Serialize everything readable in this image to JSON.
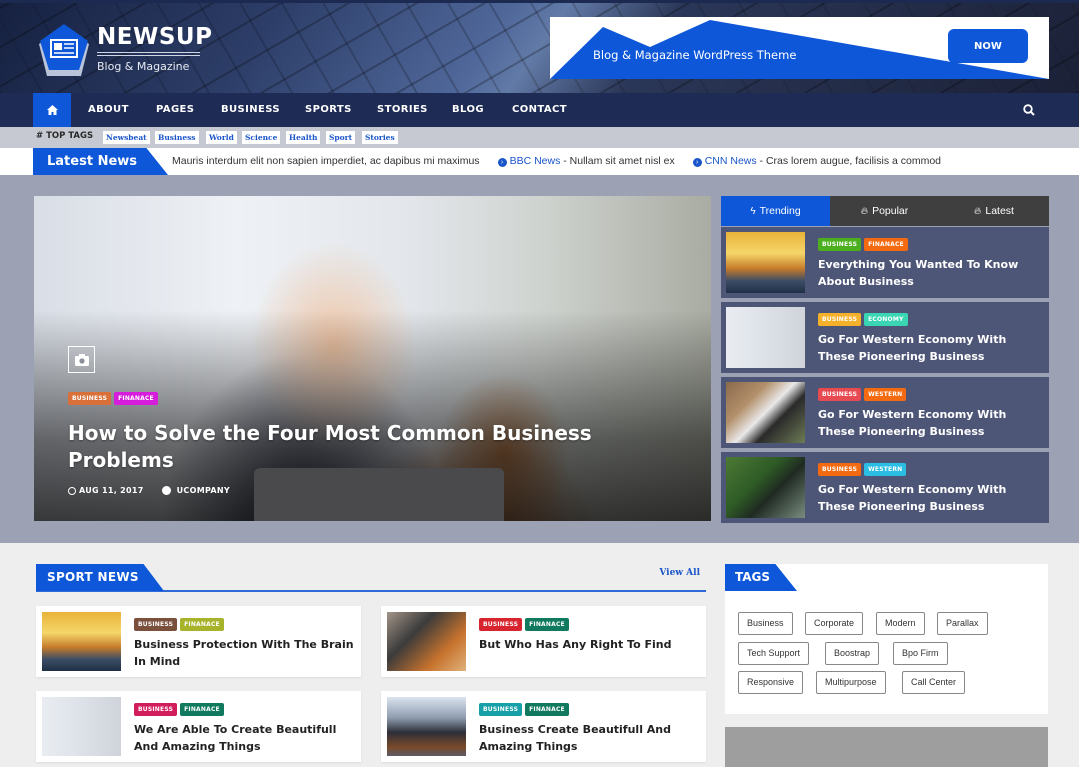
{
  "header": {
    "logo_title": "NEWSUP",
    "logo_subtitle": "Blog & Magazine",
    "ad_text": "Blog & Magazine WordPress Theme",
    "ad_button": "NOW"
  },
  "nav": {
    "home_icon": "home-icon",
    "items": [
      "ABOUT",
      "PAGES",
      "BUSINESS",
      "SPORTS",
      "STORIES",
      "BLOG",
      "CONTACT"
    ],
    "search_icon": "search-icon"
  },
  "top_tags": {
    "label": "# TOP TAGS",
    "tags": [
      "Newsbeat",
      "Business",
      "World",
      "Science",
      "Health",
      "Sport",
      "Stories"
    ]
  },
  "ticker": {
    "label": "Latest News",
    "items": [
      {
        "source": "",
        "text": "Mauris interdum elit non sapien imperdiet, ac dapibus mi maximus"
      },
      {
        "source": "BBC News",
        "text": " - Nullam sit amet nisl ex"
      },
      {
        "source": "CNN News",
        "text": " - Cras lorem augue, facilisis a commod"
      }
    ]
  },
  "hero": {
    "badges": [
      {
        "label": "BUSINESS",
        "color": "#d9703a"
      },
      {
        "label": "FINANACE",
        "color": "#d61ddb"
      }
    ],
    "title": "How to Solve the Four Most Common Business Problems",
    "date": "AUG 11, 2017",
    "author": "UCOMPANY"
  },
  "tabs": {
    "items": [
      {
        "label": "Trending",
        "icon": "bolt-icon",
        "active": true
      },
      {
        "label": "Popular",
        "icon": "fire-icon",
        "active": false
      },
      {
        "label": "Latest",
        "icon": "fire-icon",
        "active": false
      }
    ]
  },
  "trending": [
    {
      "title": "Everything You Wanted To Know About Business",
      "badges": [
        {
          "label": "BUSINESS",
          "color": "#4caf1d"
        },
        {
          "label": "FINANACE",
          "color": "#f36a10"
        }
      ]
    },
    {
      "title": "Go For Western Economy With These Pioneering Business",
      "badges": [
        {
          "label": "BUSINESS",
          "color": "#f6b12a"
        },
        {
          "label": "ECONOMY",
          "color": "#3ad6b3"
        }
      ]
    },
    {
      "title": "Go For Western Economy With These Pioneering Business",
      "badges": [
        {
          "label": "BUSINESS",
          "color": "#e84a52"
        },
        {
          "label": "WESTERN",
          "color": "#f36a10"
        }
      ]
    },
    {
      "title": "Go For Western Economy With These Pioneering Business",
      "badges": [
        {
          "label": "BUSINESS",
          "color": "#f36a10"
        },
        {
          "label": "WESTERN",
          "color": "#2cbde4"
        }
      ]
    }
  ],
  "sport_news": {
    "title": "SPORT NEWS",
    "view_all": "View All",
    "cards": [
      {
        "title": "Business Protection With The Brain In Mind",
        "badges": [
          {
            "label": "BUSINESS",
            "color": "#7a4f3c"
          },
          {
            "label": "FINANACE",
            "color": "#a6b32b"
          }
        ]
      },
      {
        "title": "But Who Has Any Right To Find",
        "badges": [
          {
            "label": "BUSINESS",
            "color": "#d8242f"
          },
          {
            "label": "FINANACE",
            "color": "#117a5e"
          }
        ]
      },
      {
        "title": "We Are Able To Create Beautifull And Amazing Things",
        "badges": [
          {
            "label": "BUSINESS",
            "color": "#d21d5c"
          },
          {
            "label": "FINANACE",
            "color": "#117a5e"
          }
        ]
      },
      {
        "title": "Business Create Beautifull And Amazing Things",
        "badges": [
          {
            "label": "BUSINESS",
            "color": "#17a0a8"
          },
          {
            "label": "FINANACE",
            "color": "#117a5e"
          }
        ]
      }
    ]
  },
  "tags_widget": {
    "title": "TAGS",
    "tags": [
      "Business",
      "Corporate",
      "Modern",
      "Parallax",
      "Tech Support",
      "Boostrap",
      "Bpo Firm",
      "Responsive",
      "Multipurpose",
      "Call Center"
    ]
  },
  "colors": {
    "primary": "#0d57d8",
    "nav_bg": "#1e2b55",
    "trend_bg": "#4e5678",
    "featured_bg": "#9ca1b3"
  }
}
